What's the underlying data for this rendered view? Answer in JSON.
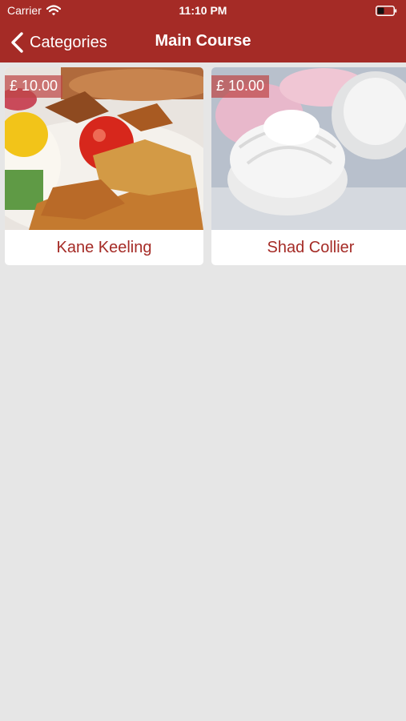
{
  "status_bar": {
    "carrier": "Carrier",
    "time": "11:10 PM"
  },
  "nav": {
    "back_label": "Categories",
    "title": "Main Course"
  },
  "items": [
    {
      "price": "£ 10.00",
      "name": "Kane Keeling"
    },
    {
      "price": "£ 10.00",
      "name": "Shad Collier"
    }
  ],
  "colors": {
    "header": "#a52b26",
    "background": "#e6e6e6",
    "item_name": "#a52b26"
  }
}
